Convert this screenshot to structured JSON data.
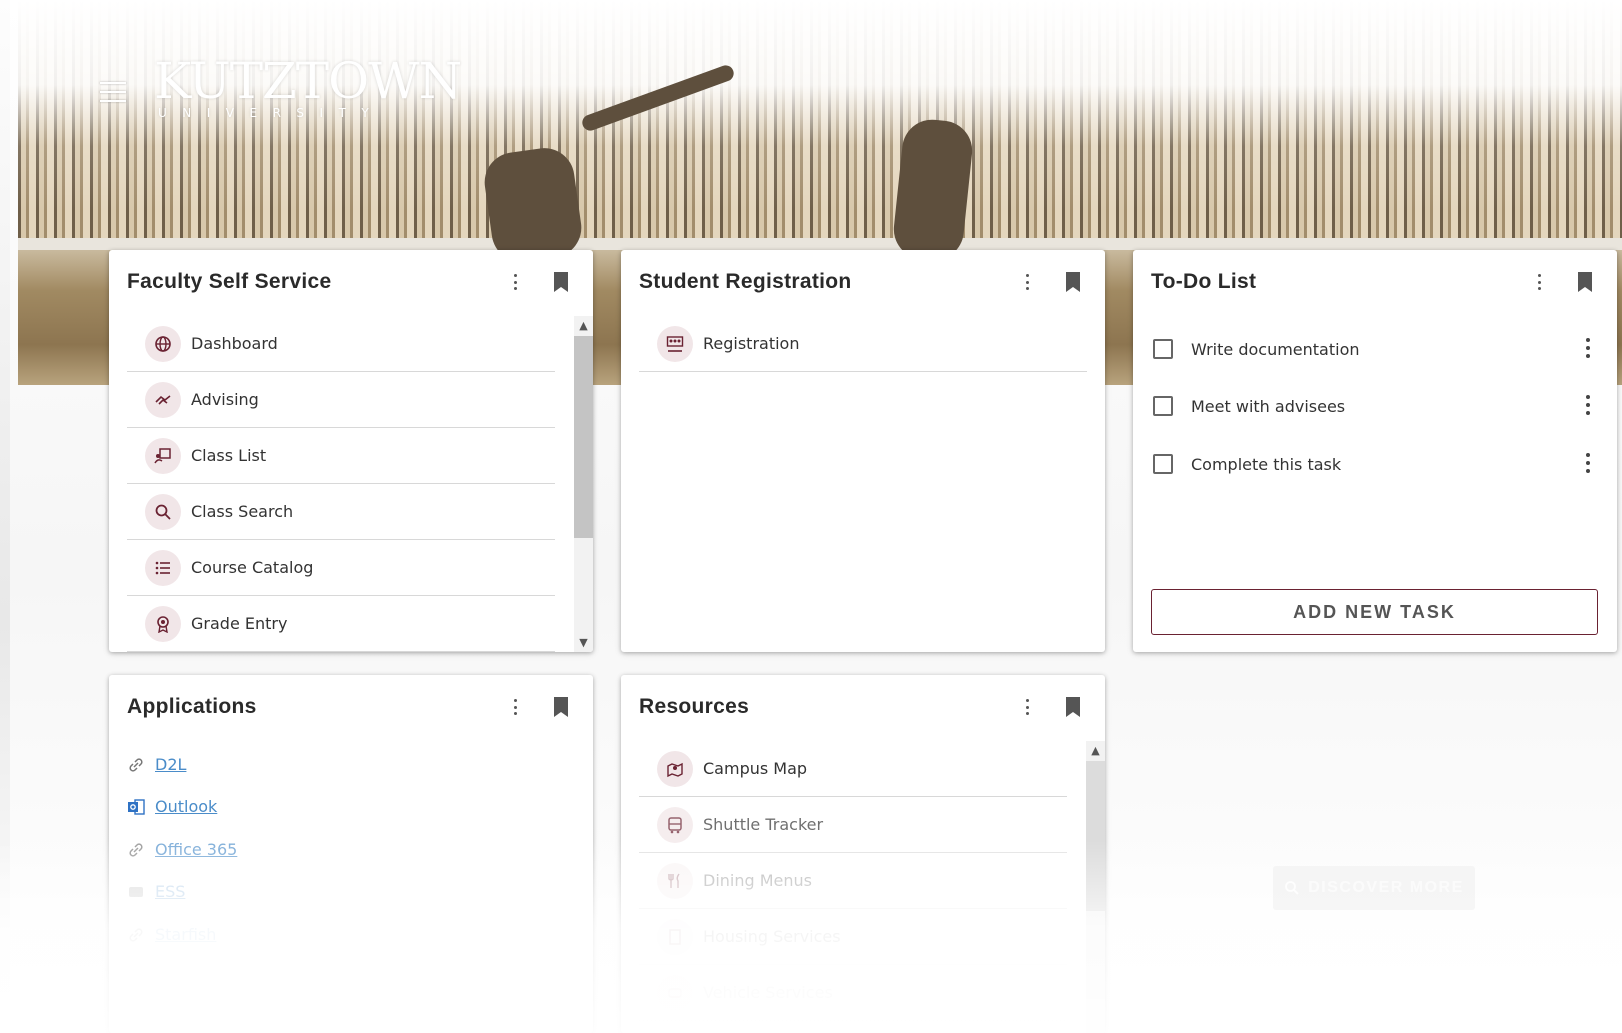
{
  "header": {
    "logo_main": "KUTZTOWN",
    "logo_sub": "UNIVERSITY"
  },
  "colors": {
    "brand": "#6a2232",
    "icon_bg": "#f1e6e8",
    "link": "#4a8cc9"
  },
  "faculty_self_service": {
    "title": "Faculty Self Service",
    "items": [
      {
        "label": "Dashboard",
        "icon": "globe-icon"
      },
      {
        "label": "Advising",
        "icon": "handshake-icon"
      },
      {
        "label": "Class List",
        "icon": "teacher-board-icon"
      },
      {
        "label": "Class Search",
        "icon": "search-icon"
      },
      {
        "label": "Course Catalog",
        "icon": "list-icon"
      },
      {
        "label": "Grade Entry",
        "icon": "award-icon"
      }
    ]
  },
  "student_registration": {
    "title": "Student Registration",
    "items": [
      {
        "label": "Registration",
        "icon": "people-icon"
      }
    ]
  },
  "todo": {
    "title": "To-Do List",
    "tasks": [
      {
        "label": "Write documentation",
        "checked": false
      },
      {
        "label": "Meet with advisees",
        "checked": false
      },
      {
        "label": "Complete this task",
        "checked": false
      }
    ],
    "add_label": "ADD NEW TASK"
  },
  "applications": {
    "title": "Applications",
    "links": [
      {
        "label": "D2L",
        "icon": "link-icon"
      },
      {
        "label": "Outlook",
        "icon": "outlook-icon"
      },
      {
        "label": "Office 365",
        "icon": "link-icon"
      },
      {
        "label": "ESS",
        "icon": "app-icon"
      },
      {
        "label": "Starfish",
        "icon": "link-icon"
      }
    ]
  },
  "resources": {
    "title": "Resources",
    "items": [
      {
        "label": "Campus Map",
        "icon": "map-icon"
      },
      {
        "label": "Shuttle Tracker",
        "icon": "bus-icon"
      },
      {
        "label": "Dining Menus",
        "icon": "utensils-icon"
      },
      {
        "label": "Housing Services",
        "icon": "building-icon"
      },
      {
        "label": "Vehicle Services",
        "icon": "car-icon"
      }
    ]
  },
  "discover": {
    "label": "DISCOVER MORE"
  }
}
